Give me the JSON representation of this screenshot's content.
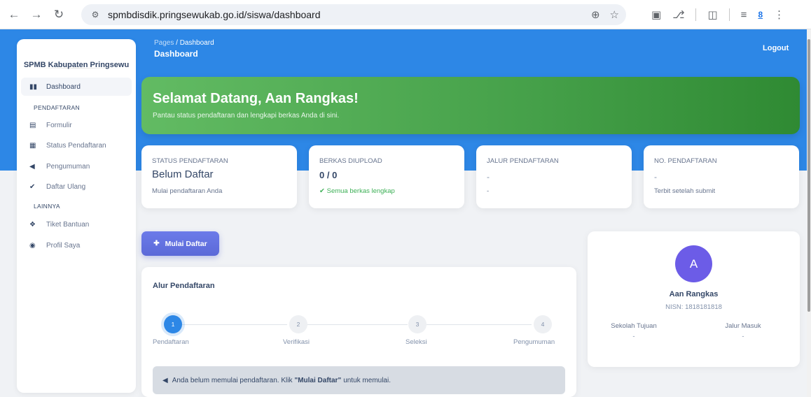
{
  "browser": {
    "url": "spmbdisdik.pringsewukab.go.id/siswa/dashboard",
    "icons": {
      "back": "arrow-left-icon",
      "forward": "arrow-right-icon",
      "reload": "reload-icon",
      "site_info": "tune-icon",
      "zoom": "zoom-icon",
      "bookmark": "star-icon"
    },
    "ext_badge": "8"
  },
  "sidebar": {
    "brand": "SPMB Kabupaten Pringsewu",
    "items": [
      {
        "label": "Dashboard",
        "icon": "bar-chart-icon",
        "active": true
      },
      {
        "label": "Formulir",
        "icon": "form-icon"
      },
      {
        "label": "Status Pendaftaran",
        "icon": "folder-icon"
      },
      {
        "label": "Pengumuman",
        "icon": "megaphone-icon"
      },
      {
        "label": "Daftar Ulang",
        "icon": "check-icon"
      },
      {
        "label": "Tiket Bantuan",
        "icon": "help-icon"
      },
      {
        "label": "Profil Saya",
        "icon": "user-icon"
      }
    ],
    "sections": [
      "PENDAFTARAN",
      "LAINNYA"
    ]
  },
  "header": {
    "breadcrumb_root": "Pages",
    "breadcrumb_sep": " / ",
    "breadcrumb_current": "Dashboard",
    "title": "Dashboard",
    "logout": "Logout"
  },
  "welcome": {
    "title": "Selamat Datang, Aan Rangkas!",
    "subtitle": "Pantau status pendaftaran dan lengkapi berkas Anda di sini."
  },
  "cards": [
    {
      "label": "STATUS PENDAFTARAN",
      "value": "Belum Daftar",
      "note": "Mulai pendaftaran Anda"
    },
    {
      "label": "BERKAS DIUPLOAD",
      "value": "0 / 0",
      "note": "Semua berkas lengkap"
    },
    {
      "label": "JALUR PENDAFTARAN",
      "value": "-",
      "note": "-"
    },
    {
      "label": "NO. PENDAFTARAN",
      "value": "-",
      "note": "Terbit setelah submit"
    }
  ],
  "mulai_button": "Mulai Daftar",
  "alur": {
    "title": "Alur Pendaftaran",
    "steps": [
      {
        "num": "1",
        "label": "Pendaftaran"
      },
      {
        "num": "2",
        "label": "Verifikasi"
      },
      {
        "num": "3",
        "label": "Seleksi"
      },
      {
        "num": "4",
        "label": "Pengumuman"
      }
    ],
    "alert_pre": "Anda belum memulai pendaftaran. Klik",
    "alert_bold": "\"Mulai Daftar\"",
    "alert_post": "untuk memulai."
  },
  "profile": {
    "initial": "A",
    "name": "Aan Rangkas",
    "nisn": "NISN: 1818181818",
    "school_label": "Sekolah Tujuan",
    "school_value": "-",
    "route_label": "Jalur Masuk",
    "route_value": "-"
  }
}
